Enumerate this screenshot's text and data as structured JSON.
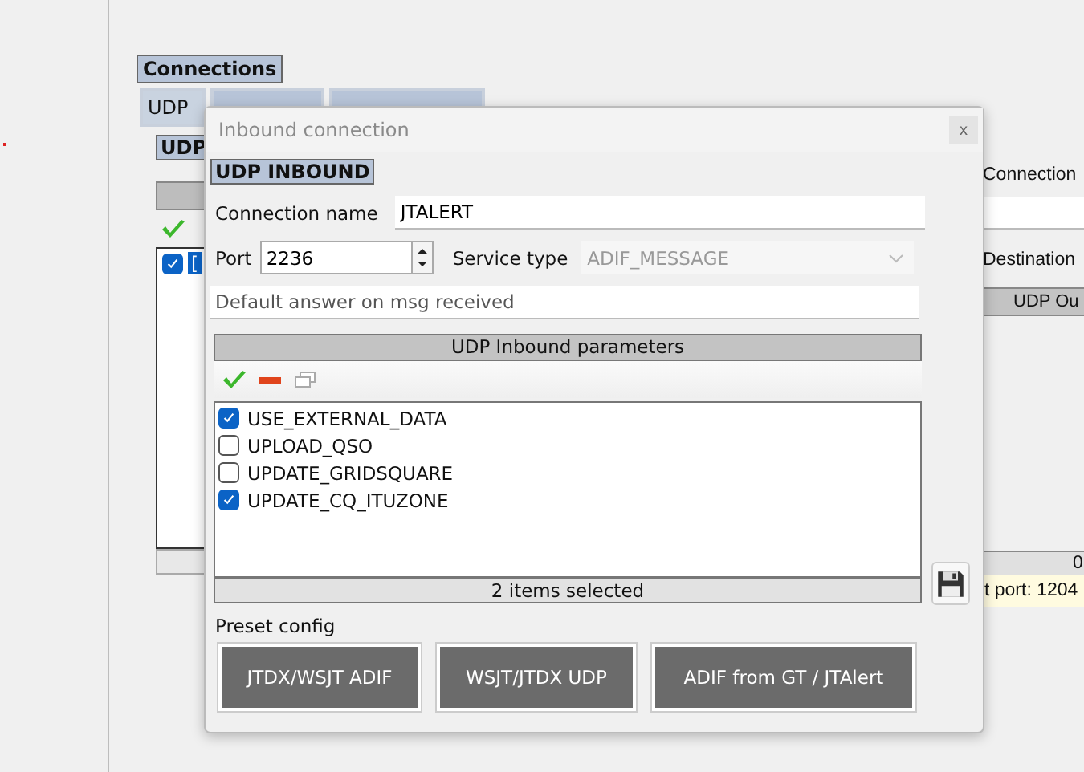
{
  "background": {
    "section_title": "Connections",
    "tabs": [
      {
        "label": "UDP",
        "selected": true
      },
      {
        "selected": false
      },
      {
        "selected": false
      }
    ],
    "group_label": "UDP",
    "list": [
      {
        "label": "[",
        "checked": true,
        "selected": true
      }
    ],
    "connection_label": "Connection",
    "destination_label": "Destination",
    "table_header": "UDP Ou",
    "table_count": "0",
    "status_text": "t port: 1204"
  },
  "dialog": {
    "title": "Inbound connection",
    "close": "x",
    "group_label": "UDP INBOUND",
    "connection_name": {
      "label": "Connection name",
      "value": "JTALERT"
    },
    "port": {
      "label": "Port",
      "value": "2236"
    },
    "service_type": {
      "label": "Service type",
      "value": "ADIF_MESSAGE",
      "disabled": true
    },
    "default_answer": {
      "placeholder": "Default answer on msg received"
    },
    "params_header": "UDP Inbound parameters",
    "params": [
      {
        "label": "USE_EXTERNAL_DATA",
        "checked": true
      },
      {
        "label": "UPLOAD_QSO",
        "checked": false
      },
      {
        "label": "UPDATE_GRIDSQUARE",
        "checked": false
      },
      {
        "label": "UPDATE_CQ_ITUZONE",
        "checked": true
      }
    ],
    "status": "2 items selected",
    "preset_label": "Preset config",
    "presets": [
      "JTDX/WSJT ADIF",
      "WSJT/JTDX UDP",
      "ADIF from GT / JTAlert"
    ]
  }
}
